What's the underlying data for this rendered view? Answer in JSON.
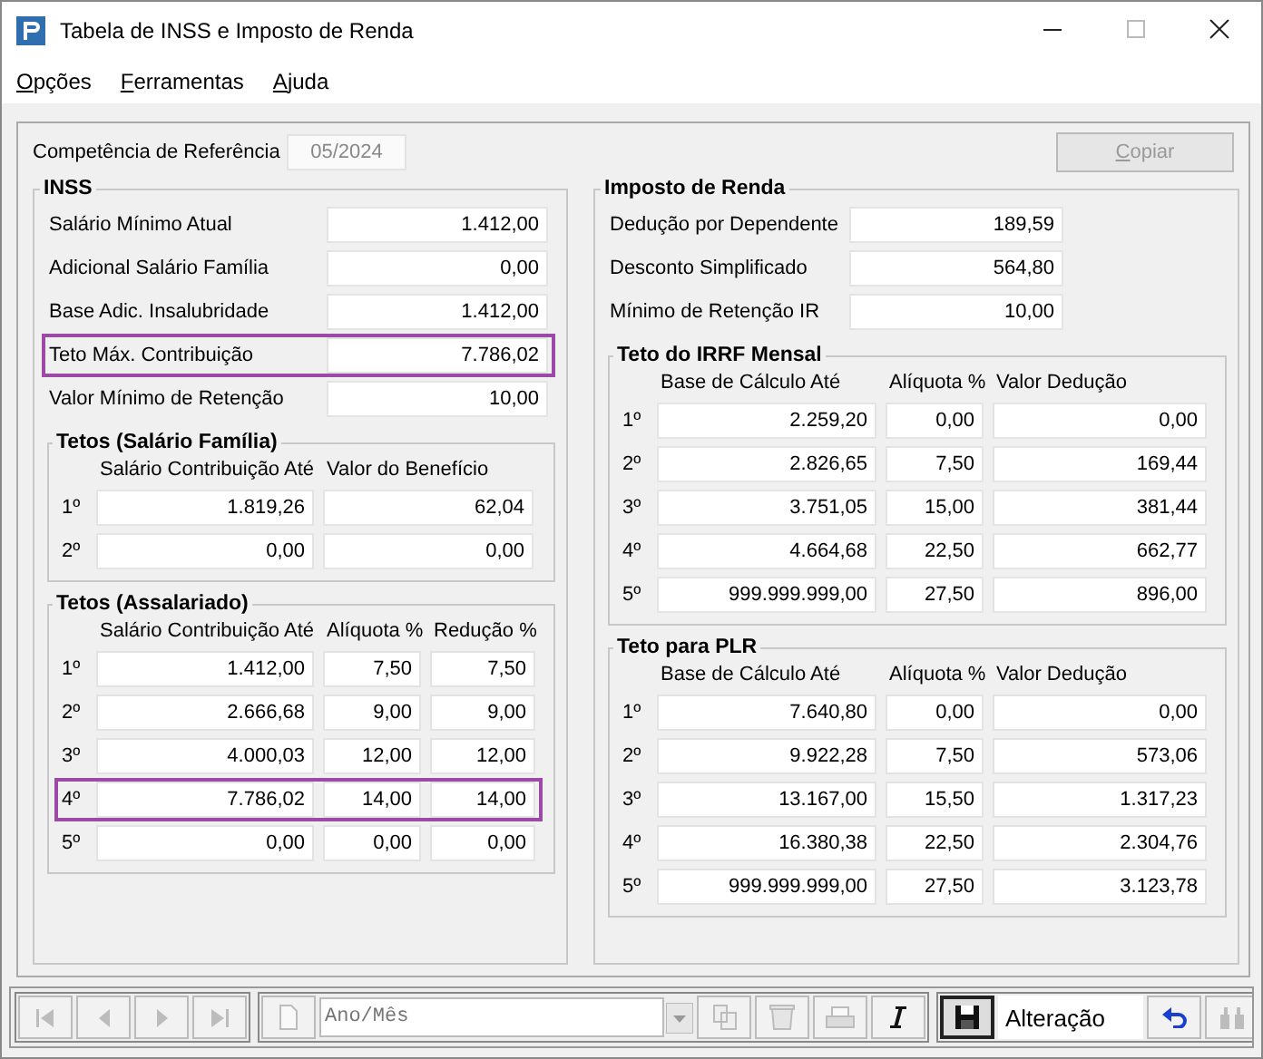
{
  "window": {
    "title": "Tabela de INSS e Imposto de Renda"
  },
  "menu": [
    {
      "label": "Opções"
    },
    {
      "label": "Ferramentas"
    },
    {
      "label": "Ajuda"
    }
  ],
  "reference": {
    "label": "Competência de Referência",
    "value": "05/2024",
    "disabled": true
  },
  "copy_button": {
    "label": "Copiar",
    "disabled": true
  },
  "inss": {
    "title": "INSS",
    "fields": [
      {
        "label": "Salário Mínimo Atual",
        "value": "1.412,00"
      },
      {
        "label": "Adicional Salário Família",
        "value": "0,00"
      },
      {
        "label": "Base Adic. Insalubridade",
        "value": "1.412,00"
      },
      {
        "label": "Teto Máx. Contribuição",
        "value": "7.786,02",
        "highlighted": true
      },
      {
        "label": "Valor Mínimo de Retenção",
        "value": "10,00"
      }
    ],
    "tables": [
      {
        "title": "Tetos (Salário Família)",
        "columns": [
          "Salário Contribuição Até",
          "Valor do Benefício"
        ],
        "rows": [
          {
            "label": "1º",
            "cells": [
              "1.819,26",
              "62,04"
            ]
          },
          {
            "label": "2º",
            "cells": [
              "0,00",
              "0,00"
            ]
          }
        ]
      },
      {
        "title": "Tetos (Assalariado)",
        "columns": [
          "Salário Contribuição Até",
          "Alíquota %",
          "Redução %"
        ],
        "rows": [
          {
            "label": "1º",
            "cells": [
              "1.412,00",
              "7,50",
              "7,50"
            ]
          },
          {
            "label": "2º",
            "cells": [
              "2.666,68",
              "9,00",
              "9,00"
            ]
          },
          {
            "label": "3º",
            "cells": [
              "4.000,03",
              "12,00",
              "12,00"
            ]
          },
          {
            "label": "4º",
            "cells": [
              "7.786,02",
              "14,00",
              "14,00"
            ],
            "highlighted": true
          },
          {
            "label": "5º",
            "cells": [
              "0,00",
              "0,00",
              "0,00"
            ]
          }
        ]
      }
    ]
  },
  "ir": {
    "title": "Imposto de Renda",
    "fields": [
      {
        "label": "Dedução por Dependente",
        "value": "189,59"
      },
      {
        "label": "Desconto Simplificado",
        "value": "564,80"
      },
      {
        "label": "Mínimo de Retenção IR",
        "value": "10,00"
      }
    ],
    "tables": [
      {
        "title": "Teto do IRRF Mensal",
        "columns": [
          "Base de Cálculo Até",
          "Alíquota %",
          "Valor Dedução"
        ],
        "rows": [
          {
            "label": "1º",
            "cells": [
              "2.259,20",
              "0,00",
              "0,00"
            ]
          },
          {
            "label": "2º",
            "cells": [
              "2.826,65",
              "7,50",
              "169,44"
            ]
          },
          {
            "label": "3º",
            "cells": [
              "3.751,05",
              "15,00",
              "381,44"
            ]
          },
          {
            "label": "4º",
            "cells": [
              "4.664,68",
              "22,50",
              "662,77"
            ]
          },
          {
            "label": "5º",
            "cells": [
              "999.999.999,00",
              "27,50",
              "896,00"
            ]
          }
        ]
      },
      {
        "title": "Teto para PLR",
        "columns": [
          "Base de Cálculo Até",
          "Alíquota %",
          "Valor Dedução"
        ],
        "rows": [
          {
            "label": "1º",
            "cells": [
              "7.640,80",
              "0,00",
              "0,00"
            ]
          },
          {
            "label": "2º",
            "cells": [
              "9.922,28",
              "7,50",
              "573,06"
            ]
          },
          {
            "label": "3º",
            "cells": [
              "13.167,00",
              "15,50",
              "1.317,23"
            ]
          },
          {
            "label": "4º",
            "cells": [
              "16.380,38",
              "22,50",
              "2.304,76"
            ]
          },
          {
            "label": "5º",
            "cells": [
              "999.999.999,00",
              "27,50",
              "3.123,78"
            ]
          }
        ]
      }
    ]
  },
  "toolbar": [
    {
      "kind": "first",
      "disabled": true,
      "pressed": false
    },
    {
      "kind": "prev",
      "disabled": true,
      "pressed": false
    },
    {
      "kind": "next",
      "disabled": true,
      "pressed": false
    },
    {
      "kind": "last",
      "disabled": true,
      "pressed": false
    },
    {
      "kind": "separator"
    },
    {
      "kind": "new",
      "disabled": true,
      "pressed": false
    },
    {
      "kind": "combo",
      "placeholder": "Ano/Mês"
    },
    {
      "kind": "copy",
      "disabled": true,
      "pressed": false
    },
    {
      "kind": "delete",
      "disabled": true,
      "pressed": false
    },
    {
      "kind": "print",
      "disabled": true,
      "pressed": false
    },
    {
      "kind": "italic",
      "disabled": false,
      "pressed": false
    },
    {
      "kind": "separator"
    },
    {
      "kind": "save",
      "disabled": false,
      "pressed": true
    },
    {
      "kind": "status",
      "text": "Alteração"
    },
    {
      "kind": "undo",
      "disabled": false,
      "pressed": false
    },
    {
      "kind": "find",
      "disabled": true,
      "pressed": false
    }
  ]
}
